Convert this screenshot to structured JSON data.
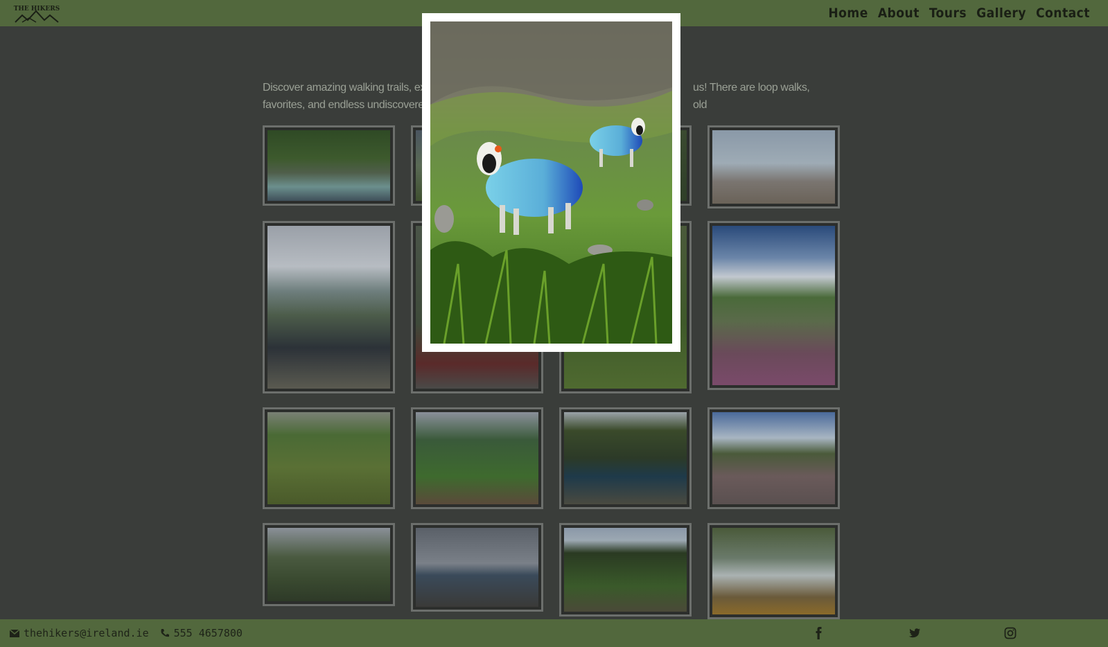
{
  "header": {
    "logo_text": "THE HIKERS",
    "nav": [
      "Home",
      "About",
      "Tours",
      "Gallery",
      "Contact"
    ]
  },
  "intro": {
    "line1_left": "Discover amazing walking trails, exper",
    "line1_right": "us! There are loop walks, old",
    "line2_left": "favorites, and endless undiscovered ar"
  },
  "lightbox": {
    "subject": "two blue-marked sheep on a grassy mountainside"
  },
  "footer": {
    "email": "thehikers@ireland.ie",
    "phone": "555 4657800",
    "social_icons": [
      "facebook-icon",
      "twitter-icon",
      "instagram-icon"
    ]
  },
  "colors": {
    "brand_green": "#52683d",
    "page_bg": "#3a3d3a"
  }
}
